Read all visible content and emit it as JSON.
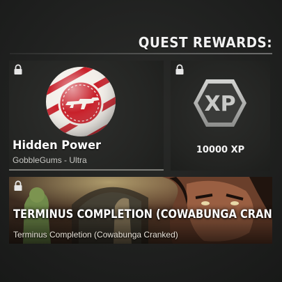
{
  "header": {
    "title": "QUEST REWARDS:"
  },
  "rewards": [
    {
      "name": "Hidden Power",
      "subtitle": "GobbleGums - Ultra",
      "icon": "gobblegum-rifle-icon",
      "locked": true
    },
    {
      "name": "10000 XP",
      "icon": "xp-hexagon-icon",
      "locked": true
    },
    {
      "name": "TERMINUS COMPLETION (COWABUNGA CRANKED)",
      "subtitle": "Terminus Completion (Cowabunga Cranked)",
      "icon": "calling-card-art",
      "locked": true
    }
  ],
  "colors": {
    "gum_red": "#c8202a",
    "gum_white": "#f3efe9",
    "xp_silver": "#b9bab8",
    "card_bg": "#242523",
    "rule": "#7c7c78"
  }
}
